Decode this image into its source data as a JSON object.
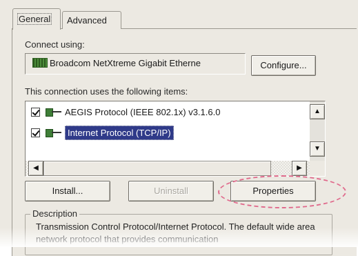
{
  "tabs": [
    {
      "label": "General",
      "active": true
    },
    {
      "label": "Advanced",
      "active": false
    }
  ],
  "connect": {
    "label": "Connect using:",
    "adapter": "Broadcom NetXtreme Gigabit Etherne",
    "configure_label": "Configure..."
  },
  "items": {
    "label": "This connection uses the following items:",
    "list": [
      {
        "label": "AEGIS Protocol (IEEE 802.1x) v3.1.6.0",
        "checked": true,
        "selected": false
      },
      {
        "label": "Internet Protocol (TCP/IP)",
        "checked": true,
        "selected": true
      }
    ]
  },
  "buttons": {
    "install": "Install...",
    "uninstall": "Uninstall",
    "properties": "Properties"
  },
  "description": {
    "legend": "Description",
    "text": "Transmission Control Protocol/Internet Protocol. The default wide area network protocol that provides communication"
  },
  "colors": {
    "selection": "#2f3a89",
    "highlight_ring": "#e06a8c",
    "dialog_bg": "#ece9e2"
  }
}
